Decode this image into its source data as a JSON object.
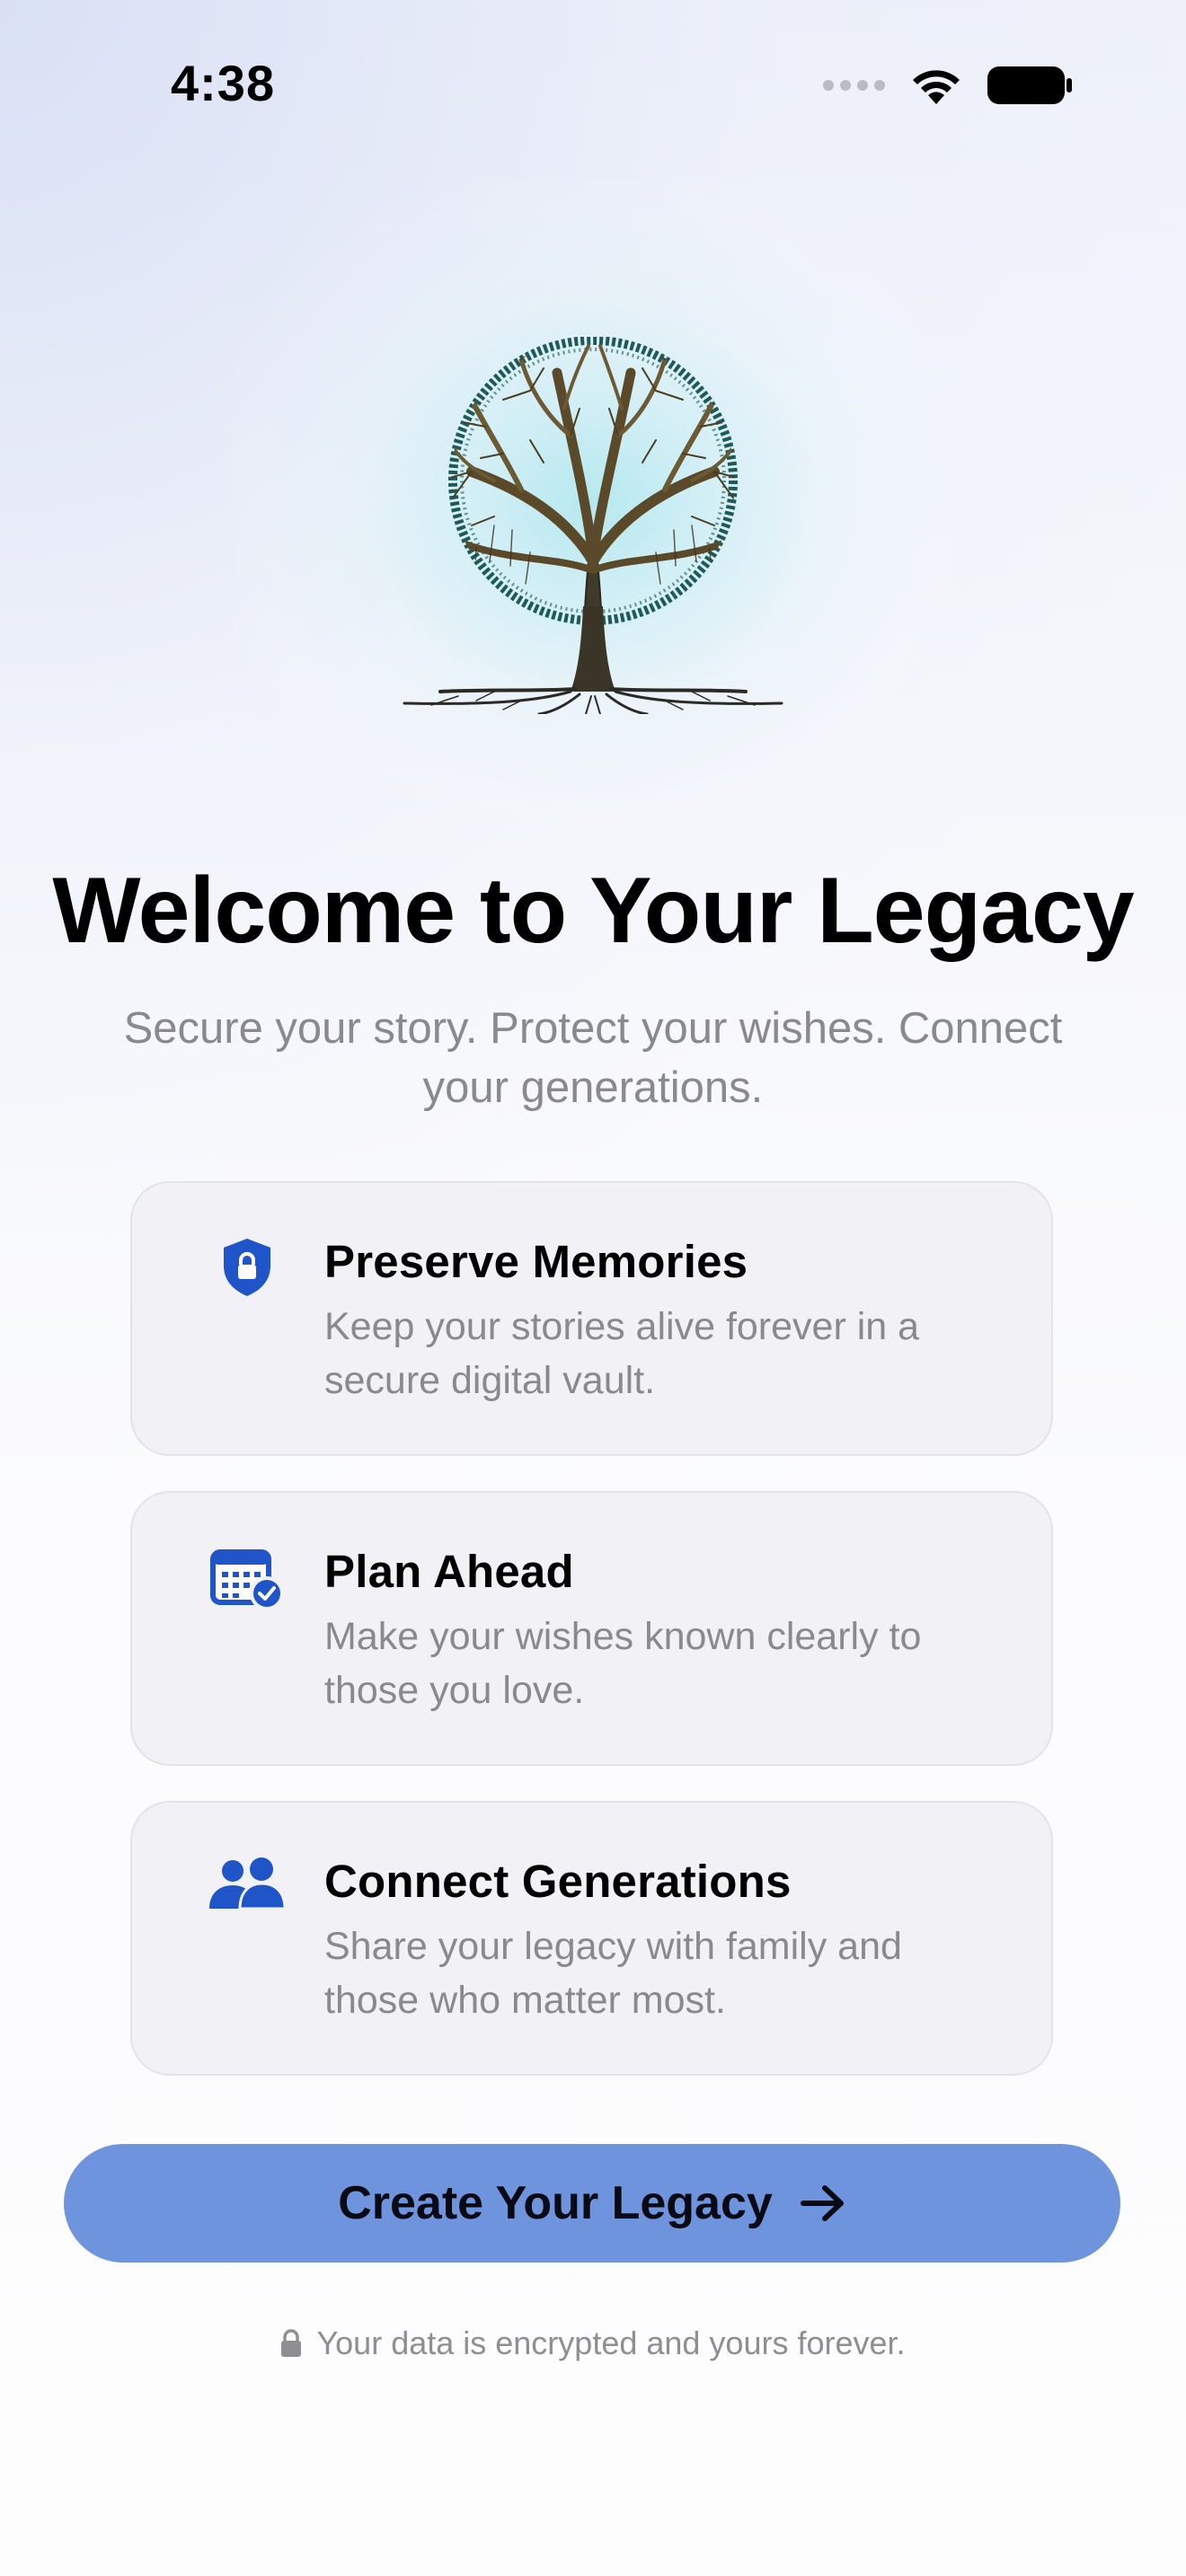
{
  "status_bar": {
    "time": "4:38"
  },
  "hero": {
    "image": "tree-of-life-illustration"
  },
  "welcome": {
    "title": "Welcome to Your Legacy",
    "subtitle": "Secure your story. Protect your wishes. Connect your generations."
  },
  "features": [
    {
      "icon": "shield-lock-icon",
      "title": "Preserve Memories",
      "description": "Keep your stories alive forever in a secure digital vault."
    },
    {
      "icon": "calendar-check-icon",
      "title": "Plan Ahead",
      "description": "Make your wishes known clearly to those you love."
    },
    {
      "icon": "people-icon",
      "title": "Connect Generations",
      "description": "Share your legacy with family and those who matter most."
    }
  ],
  "cta": {
    "label": "Create Your Legacy",
    "icon": "arrow-right-icon"
  },
  "footer": {
    "note": "Your data is encrypted and yours forever.",
    "icon": "lock-icon"
  },
  "colors": {
    "accent": "#1f55c9",
    "button": "#6f94de",
    "muted_text": "#8a8a8e",
    "card_bg": "#f2f2f6"
  }
}
